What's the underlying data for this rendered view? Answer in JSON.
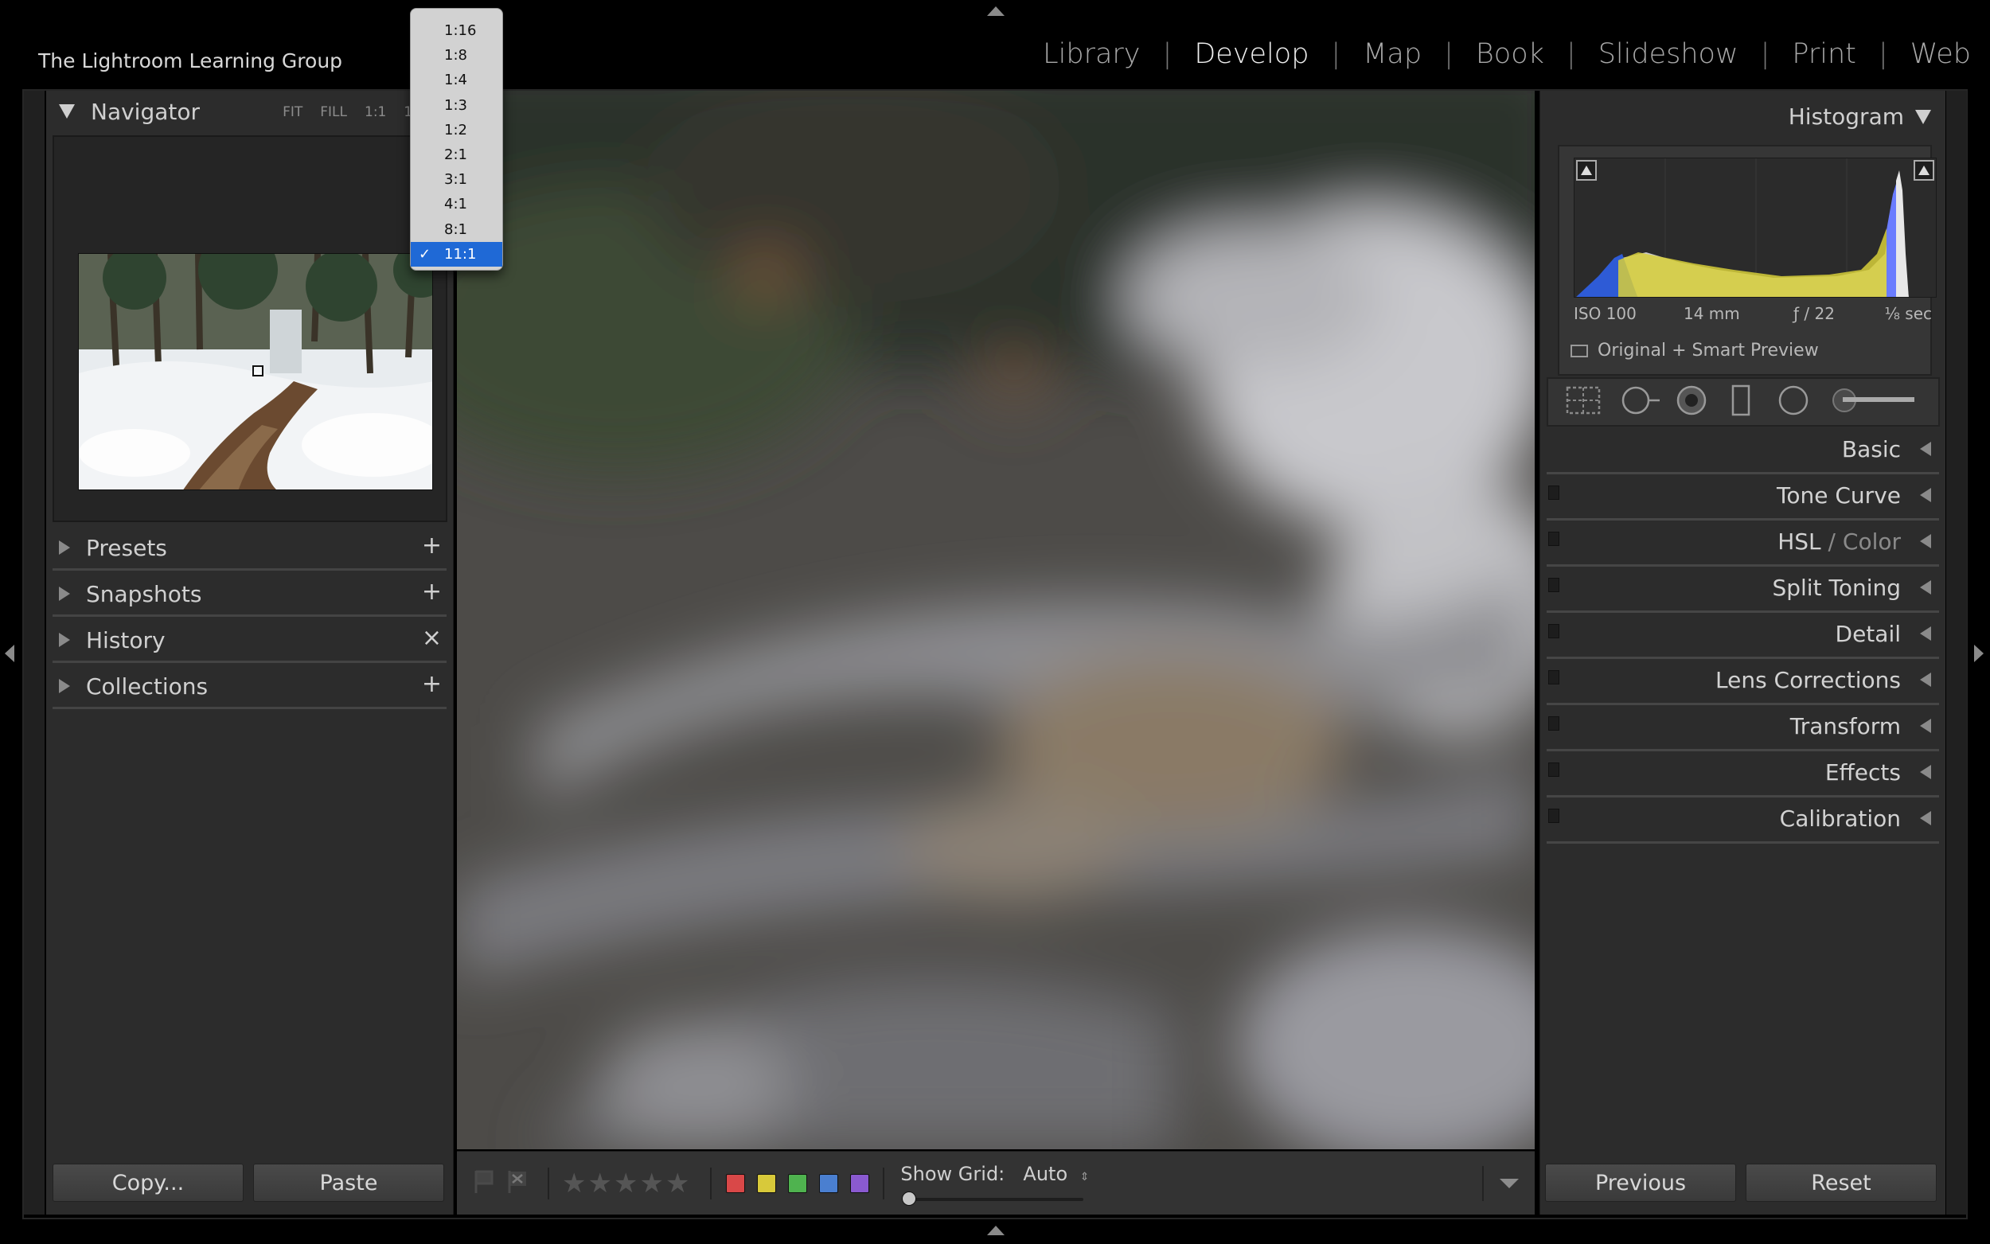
{
  "app": {
    "identity_plate": "The Lightroom Learning Group"
  },
  "modules": [
    {
      "label": "Library",
      "active": false
    },
    {
      "label": "Develop",
      "active": true
    },
    {
      "label": "Map",
      "active": false
    },
    {
      "label": "Book",
      "active": false
    },
    {
      "label": "Slideshow",
      "active": false
    },
    {
      "label": "Print",
      "active": false
    },
    {
      "label": "Web",
      "active": false
    }
  ],
  "module_separator": "|",
  "navigator": {
    "title": "Navigator",
    "zoom_options": [
      "FIT",
      "FILL",
      "1:1",
      "11"
    ]
  },
  "zoom_popup": {
    "items": [
      "1:16",
      "1:8",
      "1:4",
      "1:3",
      "1:2",
      "2:1",
      "3:1",
      "4:1",
      "8:1",
      "11:1"
    ],
    "selected": "11:1",
    "check": "✓"
  },
  "left_panels": [
    {
      "label": "Presets",
      "action": "+",
      "action_icon": "add-menu-icon"
    },
    {
      "label": "Snapshots",
      "action": "+",
      "action_icon": "add-icon"
    },
    {
      "label": "History",
      "action": "×",
      "action_icon": "clear-icon"
    },
    {
      "label": "Collections",
      "action": "+",
      "action_icon": "add-menu-icon"
    }
  ],
  "left_buttons": {
    "copy": "Copy...",
    "paste": "Paste"
  },
  "right_buttons": {
    "previous": "Previous",
    "reset": "Reset"
  },
  "histogram": {
    "title": "Histogram",
    "iso": "ISO 100",
    "focal": "14 mm",
    "aperture": "ƒ / 22",
    "shutter": "⅛ sec",
    "preview_status": "Original + Smart Preview"
  },
  "develop_sections": [
    {
      "label": "Basic",
      "switch": false
    },
    {
      "label": "Tone Curve",
      "switch": true
    },
    {
      "label": "HSL",
      "label_sep": " / ",
      "label_suffix": "Color",
      "switch": true
    },
    {
      "label": "Split Toning",
      "switch": true
    },
    {
      "label": "Detail",
      "switch": true
    },
    {
      "label": "Lens Corrections",
      "switch": true
    },
    {
      "label": "Transform",
      "switch": true
    },
    {
      "label": "Effects",
      "switch": true
    },
    {
      "label": "Calibration",
      "switch": true
    }
  ],
  "toolbar": {
    "rating_stars": 5,
    "star_glyph": "★",
    "color_labels": [
      "#d94848",
      "#d8c93a",
      "#4fb34f",
      "#4a7fd0",
      "#8a5ad0"
    ],
    "show_grid_label": "Show Grid:",
    "show_grid_value": "Auto"
  },
  "colors": {
    "selection": "#1f69d6",
    "panel_bg": "#2c2c2c"
  }
}
